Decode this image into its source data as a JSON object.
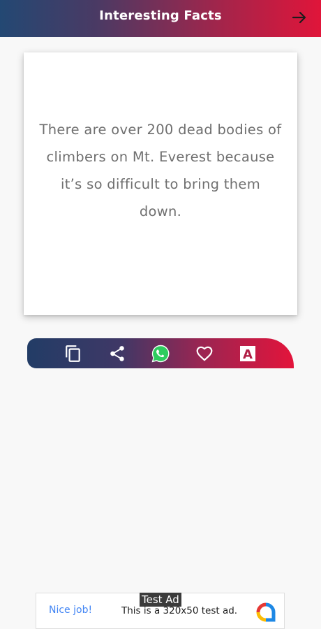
{
  "appbar": {
    "title": "Interesting Facts",
    "next_icon": "arrow-right-icon",
    "colors": [
      "#234873",
      "#e0153a"
    ]
  },
  "fact": {
    "text": "There are over 200 dead bodies of climbers on Mt. Everest because it’s so difficult to bring them down."
  },
  "actions": [
    {
      "name": "copy",
      "icon": "copy-icon"
    },
    {
      "name": "share",
      "icon": "share-icon"
    },
    {
      "name": "whatsapp",
      "icon": "whatsapp-icon"
    },
    {
      "name": "favorite",
      "icon": "heart-icon"
    },
    {
      "name": "font",
      "icon": "font-icon",
      "glyph": "A"
    }
  ],
  "ad": {
    "tag": "Test Ad",
    "cta": "Nice job!",
    "text": "This is a 320x50 test ad.",
    "logo_icon": "ad-logo-icon"
  }
}
